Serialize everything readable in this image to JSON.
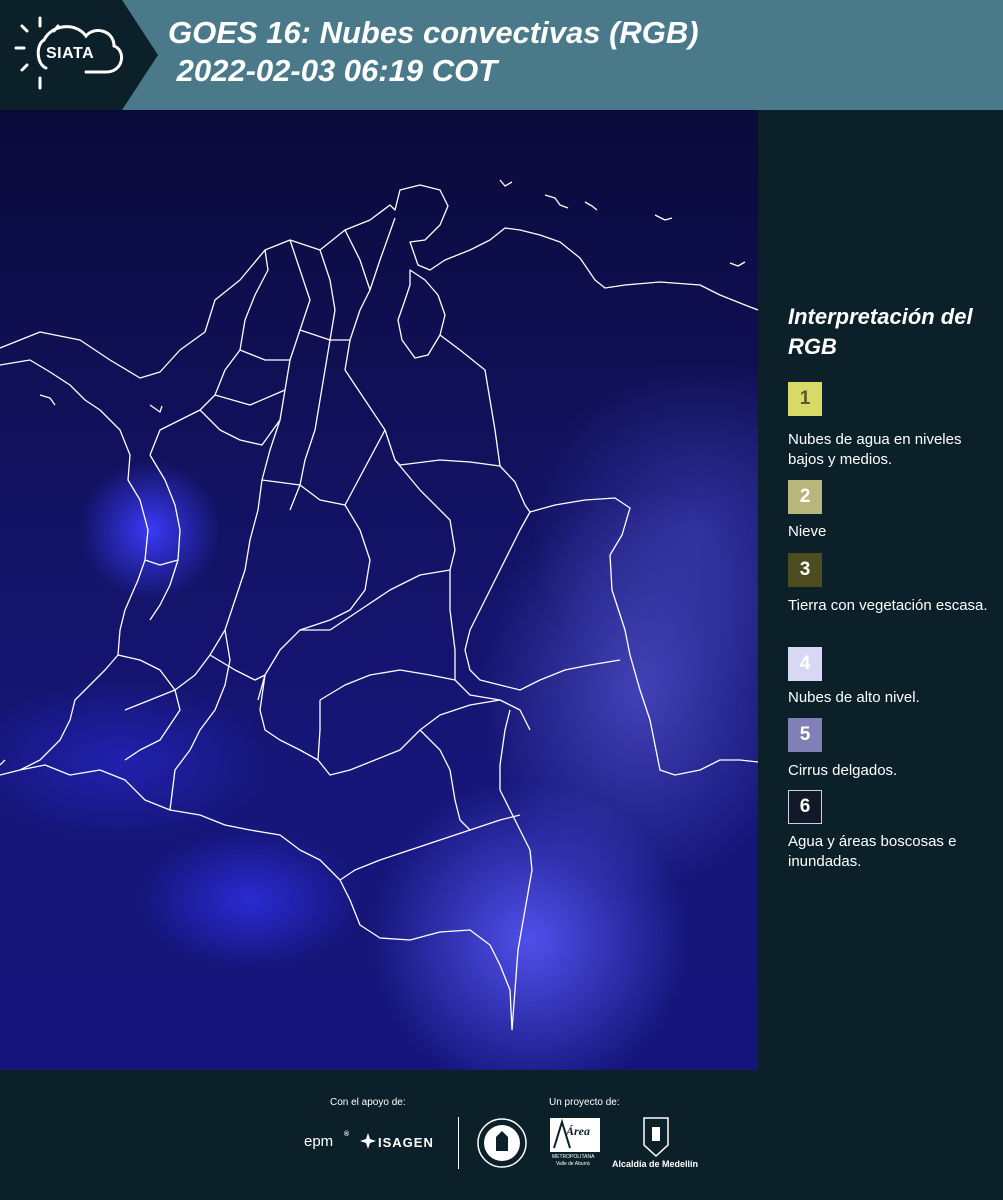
{
  "header": {
    "logo_text": "SIATA",
    "title": "GOES 16: Nubes convectivas (RGB)\n 2022-02-03 06:19 COT"
  },
  "map": {
    "icon": "satellite-rgb-map-of-colombia"
  },
  "legend": {
    "title": "Interpretación del RGB",
    "items": [
      {
        "num": "1",
        "label": "Nubes de agua en niveles bajos y medios.",
        "color": "#d9d968"
      },
      {
        "num": "2",
        "label": "Nieve",
        "color": "#b9b67c"
      },
      {
        "num": "3",
        "label": "Tierra con vegetación escasa.",
        "color": "#4c4c1e"
      },
      {
        "num": "4",
        "label": "Nubes de alto nivel.",
        "color": "#d8d8f4"
      },
      {
        "num": "5",
        "label": "Cirrus delgados.",
        "color": "#8080b6"
      },
      {
        "num": "6",
        "label": "Agua y áreas boscosas e inundadas.",
        "color": "#10182a"
      }
    ]
  },
  "footer": {
    "support_label": "Con el apoyo de:",
    "project_label": "Un proyecto de:",
    "epm": "epm",
    "isagen": "ISAGEN",
    "area": "Área",
    "area_sub": "METROPOLITANA",
    "area_sub2": "Valle de Aburrá",
    "alcaldia": "Alcaldía de Medellín"
  }
}
